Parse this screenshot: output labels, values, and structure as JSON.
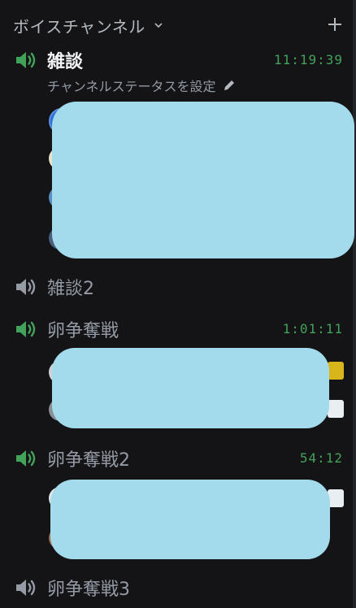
{
  "section": {
    "title": "ボイスチャンネル"
  },
  "channels": [
    {
      "name": "雑談",
      "timer": "11:19:39",
      "status": "チャンネルステータスを設定"
    },
    {
      "name": "雑談2"
    },
    {
      "name": "卵争奪戦",
      "timer": "1:01:11"
    },
    {
      "name": "卵争奪戦2",
      "timer": "54:12"
    },
    {
      "name": "卵争奪戦3"
    }
  ],
  "colors": {
    "accent_green": "#43a25a",
    "muted_gray": "#949ba4",
    "redaction": "#a3dbec",
    "background": "#141417"
  },
  "icons": {
    "speaker_active": "speaker-green-icon",
    "speaker_idle": "speaker-gray-icon",
    "add": "plus-icon",
    "collapse": "chevron-down-icon",
    "edit": "pencil-icon"
  }
}
